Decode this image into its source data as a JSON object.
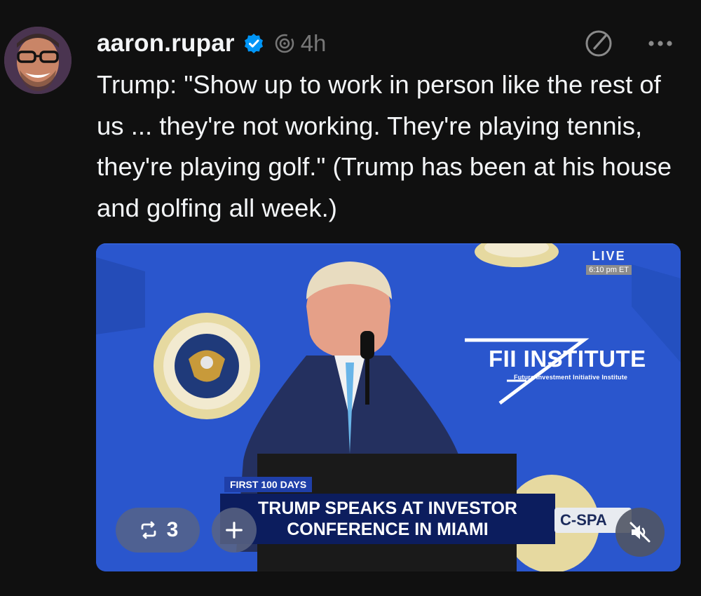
{
  "post": {
    "username": "aaron.rupar",
    "time": "4h",
    "text": "Trump: \"Show up to work in person like the rest of us ... they're not working. They're playing tennis, they're playing golf.\" (Trump has been at his house and golfing all week.)"
  },
  "video": {
    "live_label": "LIVE",
    "live_time": "6:10 pm ET",
    "fii_title": "FII INSTITUTE",
    "fii_subtitle": "Future Investment Initiative Institute",
    "lower_third_tag": "FIRST 100 DAYS",
    "lower_third_line1": "TRUMP SPEAKS AT INVESTOR",
    "lower_third_line2": "CONFERENCE IN MIAMI",
    "network": "C-SPA",
    "repost_count": "3"
  },
  "icons": {
    "verified": "verified-badge-icon",
    "thread": "threads-activity-icon",
    "compose": "compose-icon",
    "more": "more-icon",
    "repost": "repost-icon",
    "plus": "plus-icon",
    "mute": "mute-icon"
  },
  "colors": {
    "background": "#101010",
    "text": "#f3f5f7",
    "muted": "#777777",
    "verified": "#0095f6",
    "video_blue": "#2a55cc"
  }
}
